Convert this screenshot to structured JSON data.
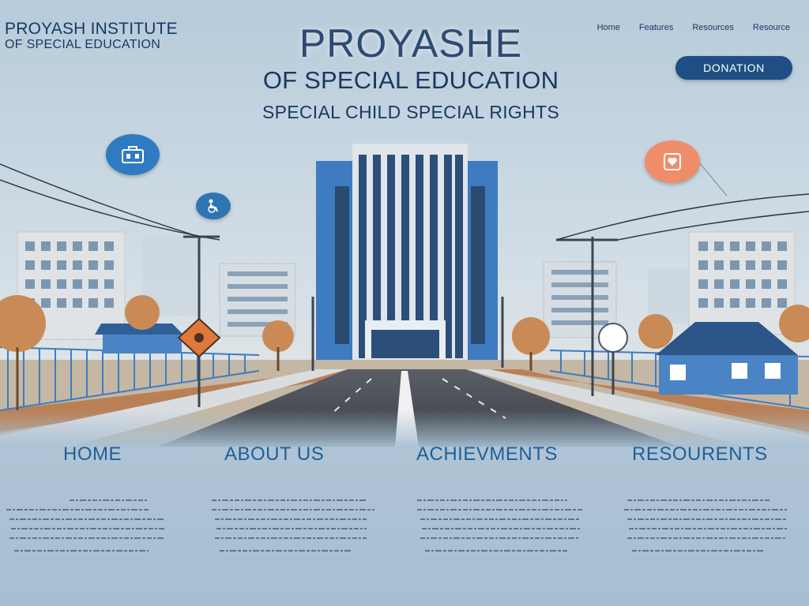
{
  "brand": {
    "line1": "PROYASH INSTITUTE",
    "line2": "OF SPECIAL EDUCATION"
  },
  "hero": {
    "title": "PROYASHE",
    "subtitle": "OF SPECIAL EDUCATION",
    "tagline": "SPECIAL CHILD SPECIAL RIGHTS"
  },
  "topnav": [
    "Home",
    "Features",
    "Resources",
    "Resource"
  ],
  "donate_label": "DONATION",
  "icons": {
    "bubble1": "building-icon",
    "bubble2": "accessibility-icon",
    "bubble3": "heart-icon",
    "road_sign": "warning-sign-icon"
  },
  "colors": {
    "sky_top": "#b9cedd",
    "accent_blue": "#1f4f82",
    "link_blue": "#1f5f98",
    "accent_orange": "#ef8d6a",
    "building_blue": "#3f7bc0"
  },
  "section_nav": [
    "HOME",
    "ABOUT US",
    "ACHIEVMENTS",
    "RESOURENTS"
  ]
}
